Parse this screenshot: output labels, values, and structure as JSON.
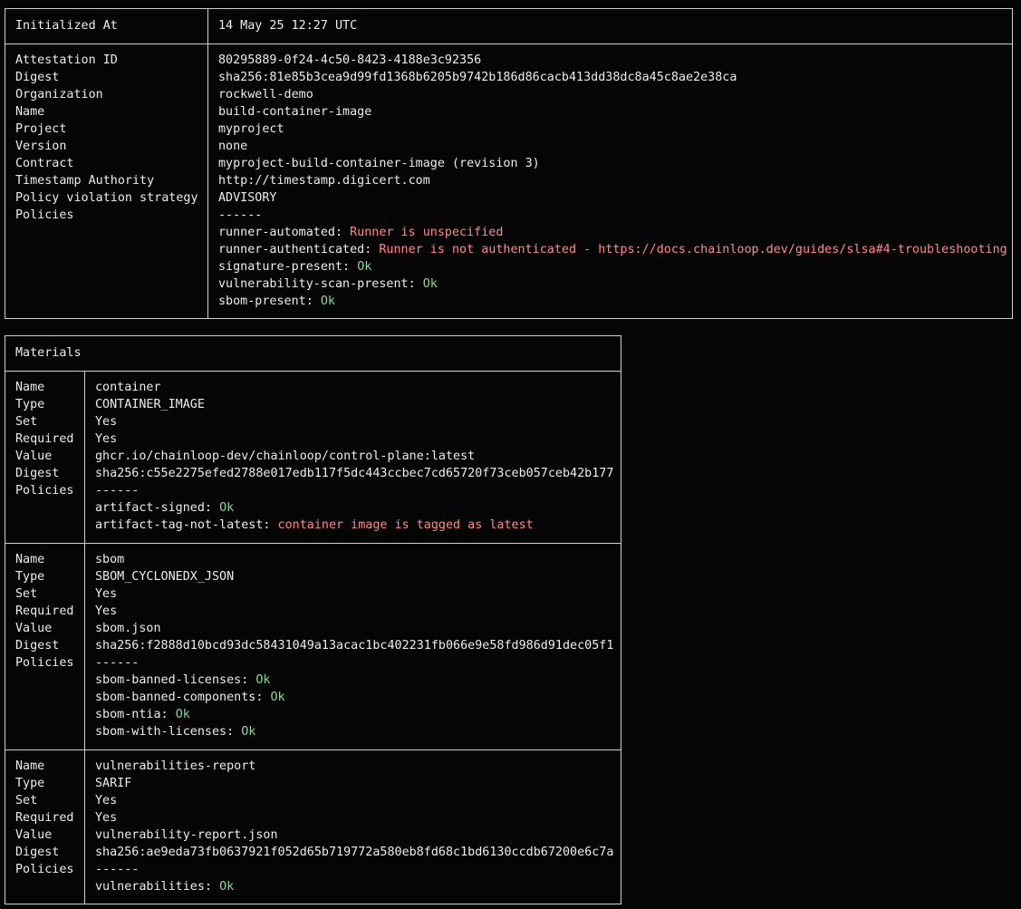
{
  "header": {
    "label": "Initialized At",
    "value": "14 May 25 12:27 UTC"
  },
  "attestation": {
    "labels": [
      "Attestation ID",
      "Digest",
      "Organization",
      "Name",
      "Project",
      "Version",
      "Contract",
      "Timestamp Authority",
      "Policy violation strategy",
      "Policies"
    ],
    "values": [
      "80295889-0f24-4c50-8423-4188e3c92356",
      "sha256:81e85b3cea9d99fd1368b6205b9742b186d86cacb413dd38dc8a45c8ae2e38ca",
      "rockwell-demo",
      "build-container-image",
      "myproject",
      "none",
      "myproject-build-container-image (revision 3)",
      "http://timestamp.digicert.com",
      "ADVISORY",
      "------"
    ],
    "policies": [
      {
        "name": "runner-automated:",
        "result": "Runner is unspecified",
        "status": "bad"
      },
      {
        "name": "runner-authenticated:",
        "result": "Runner is not authenticated - https://docs.chainloop.dev/guides/slsa#4-troubleshooting",
        "status": "bad"
      },
      {
        "name": "signature-present:",
        "result": "Ok",
        "status": "ok"
      },
      {
        "name": "vulnerability-scan-present:",
        "result": "Ok",
        "status": "ok"
      },
      {
        "name": "sbom-present:",
        "result": "Ok",
        "status": "ok"
      }
    ]
  },
  "materials": {
    "title": "Materials",
    "field_labels": [
      "Name",
      "Type",
      "Set",
      "Required",
      "Value",
      "Digest",
      "Policies"
    ],
    "items": [
      {
        "values": [
          "container",
          "CONTAINER_IMAGE",
          "Yes",
          "Yes",
          "ghcr.io/chainloop-dev/chainloop/control-plane:latest",
          "sha256:c55e2275efed2788e017edb117f5dc443ccbec7cd65720f73ceb057ceb42b177",
          "------"
        ],
        "policies": [
          {
            "name": "artifact-signed:",
            "result": "Ok",
            "status": "ok"
          },
          {
            "name": "artifact-tag-not-latest:",
            "result": "container image is tagged as latest",
            "status": "bad"
          }
        ]
      },
      {
        "values": [
          "sbom",
          "SBOM_CYCLONEDX_JSON",
          "Yes",
          "Yes",
          "sbom.json",
          "sha256:f2888d10bcd93dc58431049a13acac1bc402231fb066e9e58fd986d91dec05f1",
          "------"
        ],
        "policies": [
          {
            "name": "sbom-banned-licenses:",
            "result": "Ok",
            "status": "ok"
          },
          {
            "name": "sbom-banned-components:",
            "result": "Ok",
            "status": "ok"
          },
          {
            "name": "sbom-ntia:",
            "result": "Ok",
            "status": "ok"
          },
          {
            "name": "sbom-with-licenses:",
            "result": "Ok",
            "status": "ok"
          }
        ]
      },
      {
        "values": [
          "vulnerabilities-report",
          "SARIF",
          "Yes",
          "Yes",
          "vulnerability-report.json",
          "sha256:ae9eda73fb0637921f052d65b719772a580eb8fd68c1bd6130ccdb67200e6c7a",
          "------"
        ],
        "policies": [
          {
            "name": "vulnerabilities:",
            "result": "Ok",
            "status": "ok"
          }
        ]
      }
    ]
  },
  "colors": {
    "ok": "#8fd39f",
    "bad": "#ff8a8a",
    "text": "#ececec",
    "border": "#cfcfcf",
    "background": "#050505"
  }
}
